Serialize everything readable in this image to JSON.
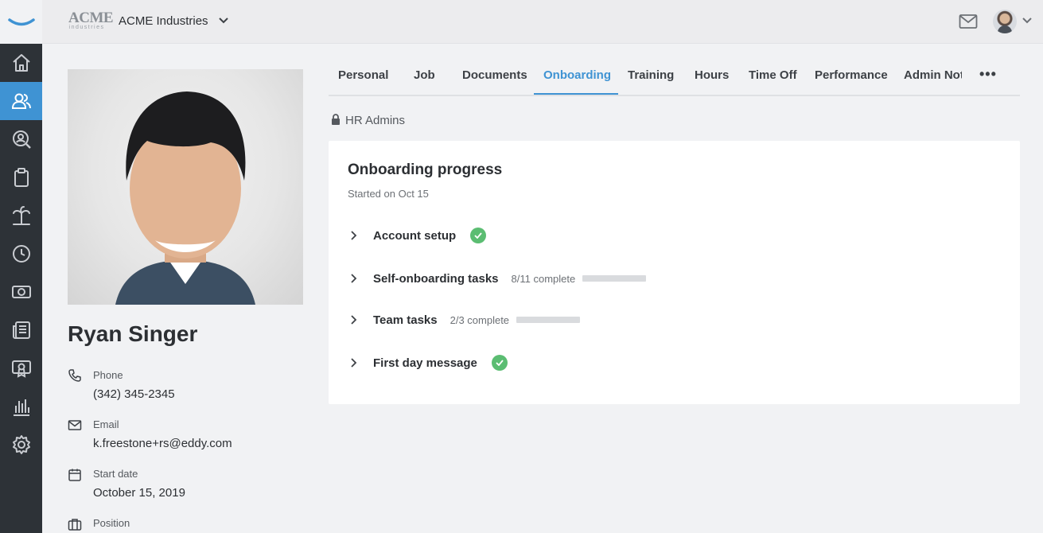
{
  "topbar": {
    "logo_text": "ACME",
    "logo_sub": "industries",
    "company": "ACME Industries"
  },
  "sidebar": {
    "items": [
      {
        "icon": "home-icon"
      },
      {
        "icon": "people-icon",
        "active": true
      },
      {
        "icon": "search-person-icon"
      },
      {
        "icon": "clipboard-icon"
      },
      {
        "icon": "palm-tree-icon"
      },
      {
        "icon": "clock-icon"
      },
      {
        "icon": "money-icon"
      },
      {
        "icon": "news-icon"
      },
      {
        "icon": "certificate-icon"
      },
      {
        "icon": "bar-chart-icon"
      },
      {
        "icon": "gear-icon"
      }
    ]
  },
  "profile": {
    "name": "Ryan Singer",
    "fields": [
      {
        "label": "Phone",
        "value": "(342) 345-2345"
      },
      {
        "label": "Email",
        "value": "k.freestone+rs@eddy.com"
      },
      {
        "label": "Start date",
        "value": "October 15, 2019"
      },
      {
        "label": "Position",
        "value": ""
      }
    ]
  },
  "tabs": [
    "Personal",
    "Job",
    "Documents",
    "Onboarding",
    "Training",
    "Hours",
    "Time Off",
    "Performance",
    "Admin Not"
  ],
  "active_tab": "Onboarding",
  "tab_more": "•••",
  "visibility": "HR Admins",
  "onboarding": {
    "title": "Onboarding progress",
    "subtitle": "Started on Oct 15",
    "sections": [
      {
        "label": "Account setup",
        "complete": true
      },
      {
        "label": "Self-onboarding tasks",
        "progress_text": "8/11 complete",
        "progress": 0.727
      },
      {
        "label": "Team tasks",
        "progress_text": "2/3 complete",
        "progress": 0.667
      },
      {
        "label": "First day message",
        "complete": true
      }
    ]
  },
  "colors": {
    "accent": "#3f93d3",
    "sidebar": "#2d3237",
    "success": "#5bbd72"
  }
}
